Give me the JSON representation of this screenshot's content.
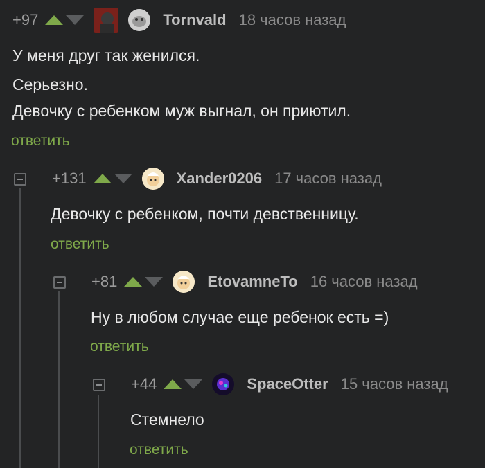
{
  "comments": [
    {
      "rating": "+97",
      "username": "Tornvald",
      "time": "18 часов назад",
      "lines": [
        "У меня друг так женился.",
        "Серьезно.",
        "Девочку с ребенком муж выгнал, он приютил."
      ],
      "reply": "ответить"
    },
    {
      "rating": "+131",
      "username": "Xander0206",
      "time": "17 часов назад",
      "lines": [
        "Девочку с ребенком, почти девственницу."
      ],
      "reply": "ответить"
    },
    {
      "rating": "+81",
      "username": "EtovamneTo",
      "time": "16 часов назад",
      "lines": [
        "Ну в любом случае еще ребенок есть =)"
      ],
      "reply": "ответить"
    },
    {
      "rating": "+44",
      "username": "SpaceOtter",
      "time": "15 часов назад",
      "lines": [
        "Стемнело"
      ],
      "reply": "ответить"
    }
  ],
  "colors": {
    "background": "#232425",
    "accent_green": "#7fa94a",
    "username": "#bdbdbd",
    "muted": "#8a8a8a"
  },
  "icons": [
    "upvote-icon",
    "downvote-icon",
    "collapse-icon",
    "avatar"
  ]
}
